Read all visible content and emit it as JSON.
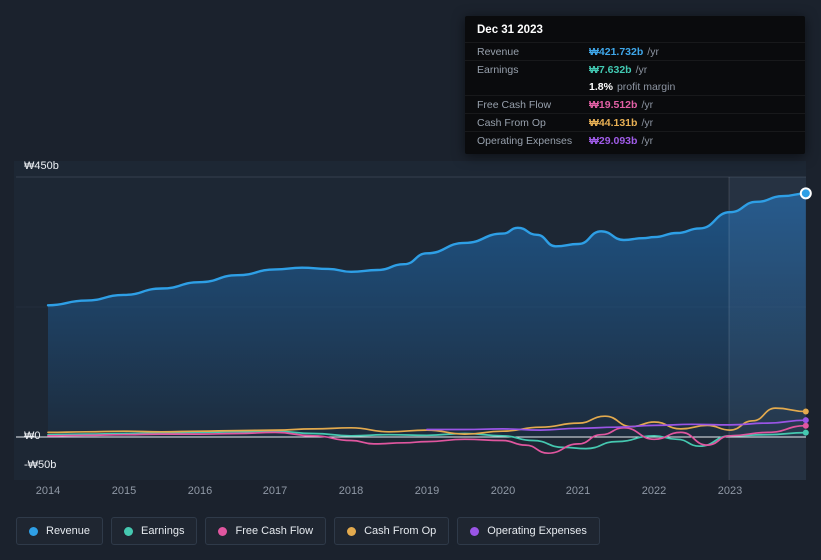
{
  "tooltip": {
    "date": "Dec 31 2023",
    "rows": [
      {
        "label": "Revenue",
        "value": "₩421.732b",
        "suffix": "/yr",
        "color": "#3fa7ea"
      },
      {
        "label": "Earnings",
        "value": "₩7.632b",
        "suffix": "/yr",
        "color": "#42c9b2"
      },
      {
        "label": "",
        "value": "1.8%",
        "suffix": "profit margin",
        "color": "#ffffff"
      },
      {
        "label": "Free Cash Flow",
        "value": "₩19.512b",
        "suffix": "/yr",
        "color": "#e360a5"
      },
      {
        "label": "Cash From Op",
        "value": "₩44.131b",
        "suffix": "/yr",
        "color": "#e8b054"
      },
      {
        "label": "Operating Expenses",
        "value": "₩29.093b",
        "suffix": "/yr",
        "color": "#a05ce8"
      }
    ]
  },
  "axes": {
    "y_labels": [
      "₩450b",
      "₩0",
      "-₩50b"
    ],
    "x_labels": [
      "2014",
      "2015",
      "2016",
      "2017",
      "2018",
      "2019",
      "2020",
      "2021",
      "2022",
      "2023"
    ]
  },
  "chart_data": {
    "type": "area+line",
    "title": "Financial history: revenue, earnings and cash flow",
    "unit": "KRW billions",
    "x_range": [
      2014,
      2024
    ],
    "ylim": [
      -50,
      450
    ],
    "grid": "horizontal",
    "legend_position": "bottom",
    "highlight_band_x": [
      2023,
      2024
    ],
    "series": [
      {
        "name": "Revenue",
        "type": "area",
        "color": "#2e9fe6",
        "x": [
          2014,
          2014.5,
          2015,
          2015.5,
          2016,
          2016.5,
          2017,
          2017.35,
          2017.7,
          2018,
          2018.35,
          2018.7,
          2019,
          2019.5,
          2020,
          2020.2,
          2020.45,
          2020.7,
          2021,
          2021.3,
          2021.6,
          2021.85,
          2022,
          2022.3,
          2022.6,
          2023,
          2023.35,
          2023.7,
          2024
        ],
        "values": [
          228,
          236,
          246,
          257,
          268,
          280,
          290,
          293,
          291,
          286,
          289,
          299,
          318,
          336,
          352,
          362,
          350,
          330,
          334,
          356,
          341,
          344,
          346,
          353,
          361,
          389,
          407,
          417,
          421.7
        ]
      },
      {
        "name": "Earnings",
        "type": "line",
        "color": "#45c8b0",
        "x": [
          2014,
          2014.5,
          2015,
          2015.5,
          2016,
          2016.5,
          2017,
          2017.5,
          2018,
          2018.5,
          2019,
          2019.5,
          2020,
          2020.4,
          2020.8,
          2021.1,
          2021.5,
          2022,
          2022.3,
          2022.6,
          2023,
          2023.5,
          2024
        ],
        "values": [
          4,
          5,
          6,
          7,
          8,
          9,
          10,
          6,
          2,
          4,
          3,
          6,
          2,
          -6,
          -18,
          -20,
          -8,
          2,
          -4,
          -16,
          2,
          4,
          7.6
        ]
      },
      {
        "name": "Free Cash Flow",
        "type": "line",
        "color": "#e0569f",
        "x": [
          2014,
          2014.5,
          2015,
          2015.5,
          2016,
          2016.5,
          2017,
          2017.5,
          2018,
          2018.3,
          2018.7,
          2019,
          2019.5,
          2020,
          2020.3,
          2020.6,
          2021,
          2021.3,
          2021.6,
          2022,
          2022.35,
          2022.7,
          2023,
          2023.5,
          2024
        ],
        "values": [
          2,
          3,
          4,
          5,
          5,
          6,
          8,
          2,
          -6,
          -12,
          -10,
          -8,
          -4,
          -6,
          -14,
          -28,
          -12,
          4,
          16,
          -4,
          8,
          -14,
          2,
          8,
          19.5
        ]
      },
      {
        "name": "Cash From Op",
        "type": "line",
        "color": "#e3aa4e",
        "x": [
          2014,
          2014.5,
          2015,
          2015.5,
          2016,
          2016.5,
          2017,
          2017.5,
          2018,
          2018.5,
          2019,
          2019.5,
          2020,
          2020.5,
          2021,
          2021.35,
          2021.7,
          2022,
          2022.35,
          2022.7,
          2023,
          2023.3,
          2023.6,
          2024
        ],
        "values": [
          8,
          9,
          10,
          9,
          10,
          11,
          12,
          14,
          16,
          9,
          12,
          5,
          10,
          17,
          24,
          36,
          18,
          26,
          14,
          20,
          12,
          28,
          50,
          44.1
        ]
      },
      {
        "name": "Operating Expenses",
        "type": "line",
        "color": "#9a55e6",
        "x": [
          2019,
          2019.5,
          2020,
          2020.5,
          2021,
          2021.5,
          2022,
          2022.5,
          2023,
          2023.5,
          2024
        ],
        "values": [
          13,
          13,
          14,
          12,
          15,
          17,
          20,
          22,
          21,
          24,
          29.1
        ]
      }
    ]
  }
}
